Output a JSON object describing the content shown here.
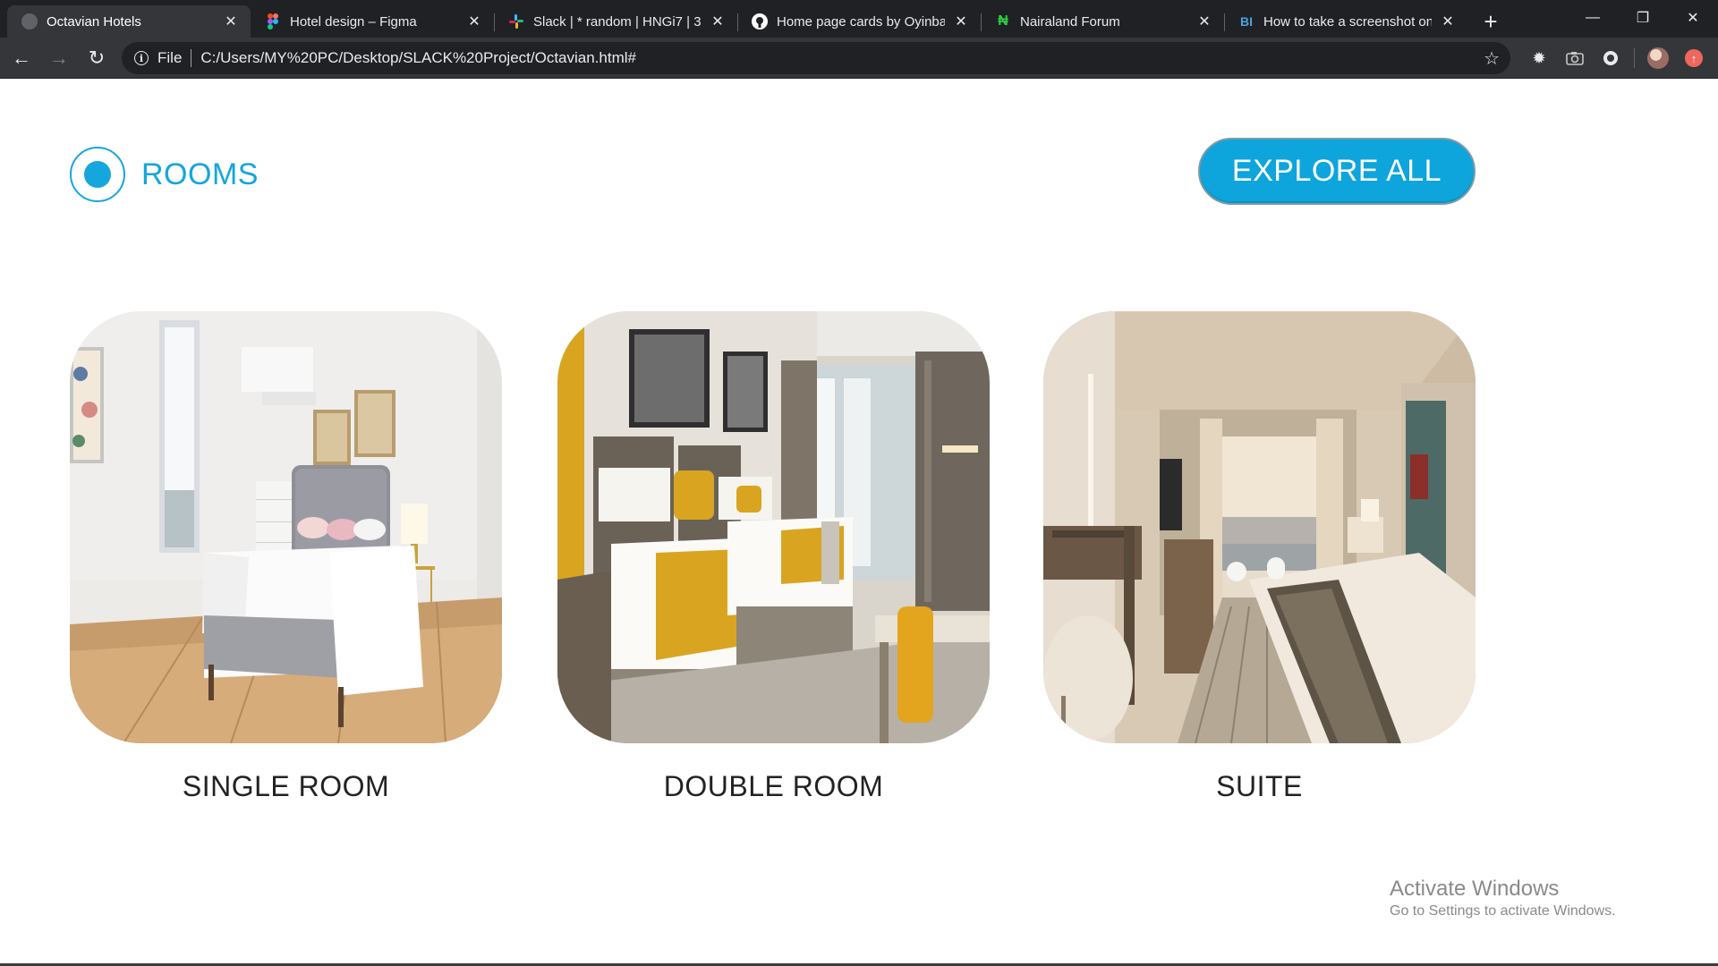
{
  "browser": {
    "tabs": [
      {
        "title": "Octavian Hotels",
        "icon": "globe-icon",
        "active": true
      },
      {
        "title": "Hotel design – Figma",
        "icon": "figma-icon"
      },
      {
        "title": "Slack | * random | HNGi7 | 3",
        "icon": "slack-icon"
      },
      {
        "title": "Home page cards by Oyinba",
        "icon": "github-icon"
      },
      {
        "title": "Nairaland Forum",
        "icon": "nairaland-icon"
      },
      {
        "title": "How to take a screenshot on",
        "icon": "bi-icon"
      }
    ],
    "address": {
      "scheme_label": "File",
      "url": "C:/Users/MY%20PC/Desktop/SLACK%20Project/Octavian.html#"
    }
  },
  "page": {
    "section_title": "ROOMS",
    "explore_label": "EXPLORE ALL",
    "rooms": [
      {
        "name": "SINGLE ROOM"
      },
      {
        "name": "DOUBLE ROOM"
      },
      {
        "name": "SUITE"
      }
    ],
    "accent_color": "#15a6dd"
  },
  "watermark": {
    "title": "Activate Windows",
    "subtitle": "Go to Settings to activate Windows."
  }
}
